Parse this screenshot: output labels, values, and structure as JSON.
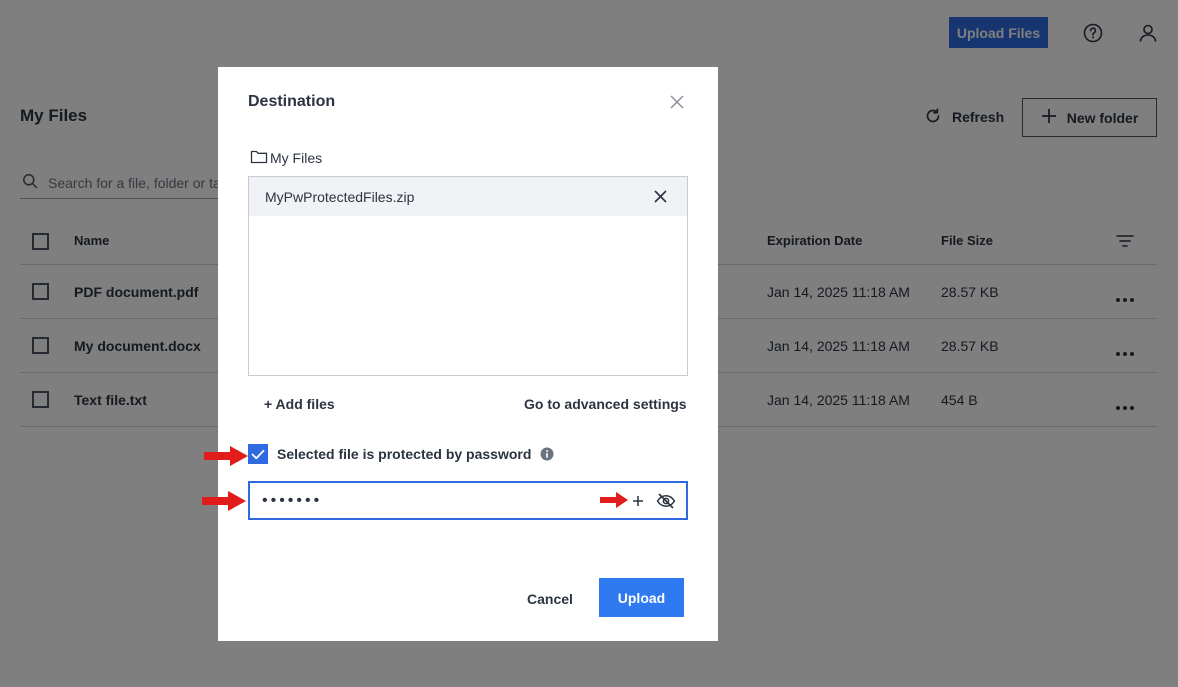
{
  "topbar": {
    "upload_label": "Upload Files",
    "help_icon": "help-circle-icon",
    "user_icon": "user-icon"
  },
  "files": {
    "title": "My Files",
    "refresh_label": "Refresh",
    "new_folder_label": "New folder",
    "search_placeholder": "Search for a file, folder or tag"
  },
  "table": {
    "columns": {
      "name": "Name",
      "expiration": "Expiration Date",
      "size": "File Size"
    },
    "rows": [
      {
        "name": "PDF document.pdf",
        "expiration": "Jan 14, 2025 11:18 AM",
        "size": "28.57 KB"
      },
      {
        "name": "My document.docx",
        "expiration": "Jan 14, 2025 11:18 AM",
        "size": "28.57 KB"
      },
      {
        "name": "Text file.txt",
        "expiration": "Jan 14, 2025 11:18 AM",
        "size": "454 B"
      }
    ]
  },
  "modal": {
    "title": "Destination",
    "destination_folder": "My Files",
    "selected_file": "MyPwProtectedFiles.zip",
    "add_files_label": "+ Add files",
    "advanced_label": "Go to advanced settings",
    "password_checkbox_label": "Selected file is protected by password",
    "password_checked": true,
    "password_value": "1234567",
    "cancel_label": "Cancel",
    "upload_label": "Upload"
  },
  "colors": {
    "accent": "#2f6ae0",
    "annotation_arrow": "#e21b1b",
    "overlay": "rgba(0,0,0,0.5)"
  }
}
